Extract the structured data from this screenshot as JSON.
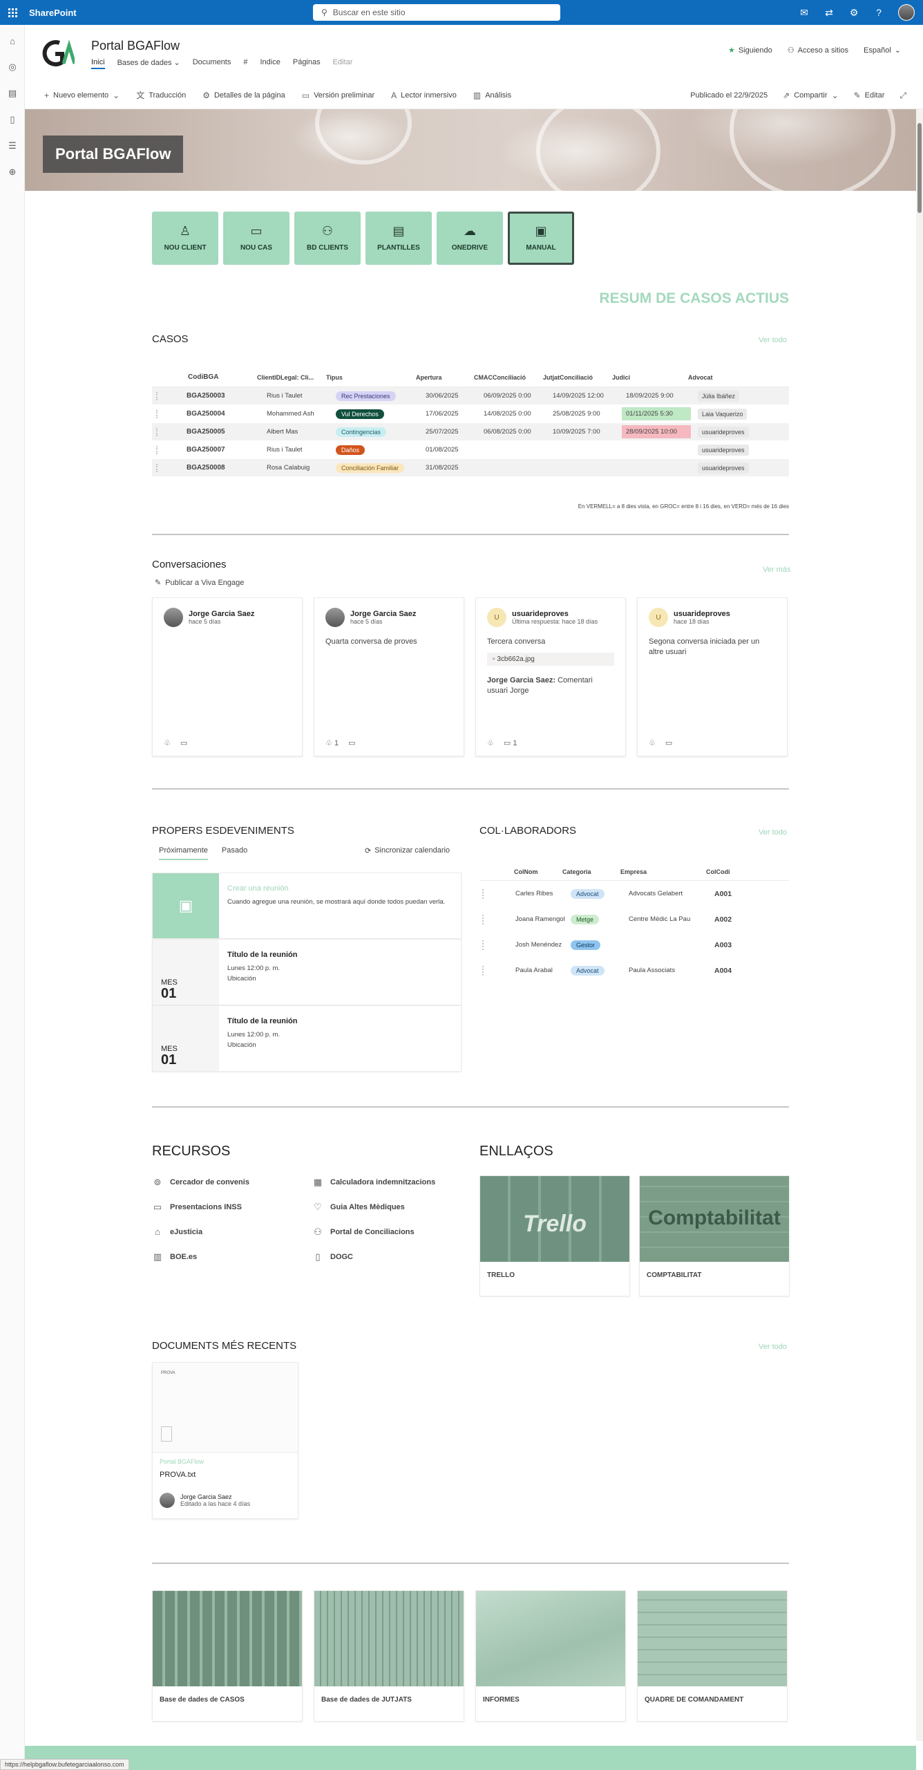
{
  "suite": {
    "brand": "SharePoint",
    "search_placeholder": "Buscar en este sitio"
  },
  "site": {
    "title": "Portal BGAFlow",
    "nav": [
      "Inici",
      "Bases de dades",
      "Documents",
      "#",
      "Indice",
      "Páginas",
      "Editar"
    ],
    "following": "Siguiendo",
    "site_access": "Acceso a sitios",
    "language": "Español"
  },
  "commandbar": {
    "new_item": "Nuevo elemento",
    "translation": "Traducción",
    "page_details": "Detalles de la página",
    "preview": "Versión preliminar",
    "immersive_reader": "Lector inmersivo",
    "analytics": "Análisis",
    "published": "Publicado el 22/9/2025",
    "share": "Compartir",
    "edit": "Editar"
  },
  "hero": {
    "title": "Portal BGAFlow"
  },
  "tiles": [
    {
      "label": "NOU CLIENT",
      "icon": "user-add-icon",
      "glyph": "♙"
    },
    {
      "label": "NOU CAS",
      "icon": "folder-icon",
      "glyph": "▭"
    },
    {
      "label": "BD CLIENTS",
      "icon": "people-icon",
      "glyph": "⚇"
    },
    {
      "label": "PLANTILLES",
      "icon": "document-template-icon",
      "glyph": "▤"
    },
    {
      "label": "ONEDRIVE",
      "icon": "cloud-icon",
      "glyph": "☁"
    },
    {
      "label": "MANUAL",
      "icon": "book-icon",
      "glyph": "▣"
    }
  ],
  "resum_title": "RESUM DE CASOS ACTIUS",
  "cases": {
    "title": "CASOS",
    "see_all": "Ver todo",
    "columns": [
      "CodiBGA",
      "ClientIDLegal: Cli...",
      "Tipus",
      "Apertura",
      "CMACConciliació",
      "JutjatConciliació",
      "Judici",
      "Advocat"
    ],
    "rows": [
      {
        "cod": "BGA250003",
        "client": "Rius i Taulet",
        "tipus": "Rec Prestaciones",
        "tipus_bg": "#d6d3f5",
        "tipus_fg": "#3b3a7a",
        "apertura": "30/06/2025",
        "cmac": "06/09/2025 0:00",
        "jutjat": "14/09/2025 12:00",
        "judici": "18/09/2025 9:00",
        "judici_bg": "",
        "advocat": "Júlia Ibáñez"
      },
      {
        "cod": "BGA250004",
        "client": "Mohammed Ash",
        "tipus": "Vul Derechos",
        "tipus_bg": "#12503e",
        "tipus_fg": "#ffffff",
        "apertura": "17/06/2025",
        "cmac": "14/08/2025 0:00",
        "jutjat": "25/08/2025 9:00",
        "judici": "01/11/2025 5:30",
        "judici_bg": "#bfe8c5",
        "advocat": "Laia Vaquerizo"
      },
      {
        "cod": "BGA250005",
        "client": "Albert Mas",
        "tipus": "Contingencias",
        "tipus_bg": "#c9eef2",
        "tipus_fg": "#1d5c66",
        "apertura": "25/07/2025",
        "cmac": "06/08/2025 0:00",
        "jutjat": "10/09/2025 7:00",
        "judici": "28/09/2025 10:00",
        "judici_bg": "#f6b9bf",
        "advocat": "usuarideproves"
      },
      {
        "cod": "BGA250007",
        "client": "Rius i Taulet",
        "tipus": "Daños",
        "tipus_bg": "#d2541c",
        "tipus_fg": "#ffffff",
        "apertura": "01/08/2025",
        "cmac": "",
        "jutjat": "",
        "judici": "",
        "judici_bg": "",
        "advocat": "usuarideproves"
      },
      {
        "cod": "BGA250008",
        "client": "Rosa Calabuig",
        "tipus": "Conciliación Familiar",
        "tipus_bg": "#fbe6bd",
        "tipus_fg": "#7a5b12",
        "apertura": "31/08/2025",
        "cmac": "",
        "jutjat": "",
        "judici": "",
        "judici_bg": "",
        "advocat": "usuarideproves"
      }
    ],
    "legend": "En VERMELL= a 8 dies vista, en GROC= entre 8 i 16 dies, en VERD= més de 16 dies"
  },
  "conversations": {
    "title": "Conversaciones",
    "see_more": "Ver más",
    "publish": "Publicar a Viva Engage",
    "cards": [
      {
        "name": "Jorge Garcia Saez",
        "sub": "hace 5 días",
        "initial": "",
        "body": "",
        "file": "",
        "reply_name": "",
        "reply_text": "",
        "likes": "",
        "comments": ""
      },
      {
        "name": "Jorge Garcia Saez",
        "sub": "hace 5 días",
        "initial": "",
        "body": "Quarta conversa de proves",
        "file": "",
        "reply_name": "",
        "reply_text": "",
        "likes": "1",
        "comments": ""
      },
      {
        "name": "usuarideproves",
        "sub": "Última respuesta: hace 18 días",
        "initial": "U",
        "body": "Tercera conversa",
        "file": "3cb662a.jpg",
        "reply_name": "Jorge Garcia Saez:",
        "reply_text": " Comentari usuari Jorge",
        "likes": "",
        "comments": "1"
      },
      {
        "name": "usuarideproves",
        "sub": "hace 18 días",
        "initial": "U",
        "body": "Segona conversa iniciada per un altre usuari",
        "file": "",
        "reply_name": "",
        "reply_text": "",
        "likes": "",
        "comments": ""
      }
    ]
  },
  "events": {
    "title": "PROPERS ESDEVENIMENTS",
    "tab_upcoming": "Próximamente",
    "tab_past": "Pasado",
    "sync": "Sincronizar calendario",
    "create_title": "Crear una reunión",
    "create_text": "Cuando agregue una reunión, se mostrará aquí donde todos puedan verla.",
    "items": [
      {
        "mes": "MES",
        "day": "01",
        "title": "Título de la reunión",
        "time": "Lunes 12:00 p. m.",
        "place": "Ubicación"
      },
      {
        "mes": "MES",
        "day": "01",
        "title": "Título de la reunión",
        "time": "Lunes 12:00 p. m.",
        "place": "Ubicación"
      }
    ]
  },
  "collaborators": {
    "title": "COL·LABORADORS",
    "see_all": "Ver todo",
    "columns": [
      "ColNom",
      "Categoria",
      "Empresa",
      "ColCodi"
    ],
    "rows": [
      {
        "nom": "Carles Ribes",
        "cat": "Advocat",
        "cat_bg": "#cfe4f7",
        "cat_fg": "#1f4e79",
        "empresa": "Advocats Gelabert",
        "codi": "A001"
      },
      {
        "nom": "Joana Ramengol",
        "cat": "Metge",
        "cat_bg": "#cdeccf",
        "cat_fg": "#24602a",
        "empresa": "Centre Mèdic La Pau",
        "codi": "A002"
      },
      {
        "nom": "Josh Menéndez",
        "cat": "Gestor",
        "cat_bg": "#8fc4ef",
        "cat_fg": "#0f3d66",
        "empresa": "",
        "codi": "A003"
      },
      {
        "nom": "Paula Arabal",
        "cat": "Advocat",
        "cat_bg": "#cfe4f7",
        "cat_fg": "#1f4e79",
        "empresa": "Paula Associats",
        "codi": "A004"
      }
    ]
  },
  "resources": {
    "title": "RECURSOS",
    "items": [
      {
        "label": "Cercador de convenis",
        "icon": "search-person-icon",
        "glyph": "⊚"
      },
      {
        "label": "Calculadora indemnitzacions",
        "icon": "calculator-icon",
        "glyph": "▦"
      },
      {
        "label": "Presentacions INSS",
        "icon": "folder-open-icon",
        "glyph": "▭"
      },
      {
        "label": "Guia Altes Mèdiques",
        "icon": "heart-pulse-icon",
        "glyph": "♡"
      },
      {
        "label": "eJusticia",
        "icon": "building-icon",
        "glyph": "⌂"
      },
      {
        "label": "Portal de Conciliacions",
        "icon": "people-swap-icon",
        "glyph": "⚇"
      },
      {
        "label": "BOE.es",
        "icon": "library-icon",
        "glyph": "▥"
      },
      {
        "label": "DOGC",
        "icon": "document-search-icon",
        "glyph": "▯"
      }
    ]
  },
  "links": {
    "title": "ENLLAÇOS",
    "items": [
      {
        "label": "TRELLO",
        "img_text": "Trello"
      },
      {
        "label": "COMPTABILITAT",
        "img_text": "Comptabilitat"
      }
    ]
  },
  "documents": {
    "title": "DOCUMENTS MÉS RECENTS",
    "see_all": "Ver todo",
    "doc": {
      "preview_text": "PROVA",
      "site": "Portal BGAFlow",
      "name": "PROVA.txt",
      "author": "Jorge Garcia Saez",
      "edited": "Editado a las hace 4 días"
    }
  },
  "quicklinks": [
    {
      "label": "Base de dades de CASOS"
    },
    {
      "label": "Base de dades de JUTJATS"
    },
    {
      "label": "INFORMES"
    },
    {
      "label": "QUADRE DE COMANDAMENT"
    }
  ],
  "status_url": "https://helpbgaflow.bufetegarciaalonso.com"
}
